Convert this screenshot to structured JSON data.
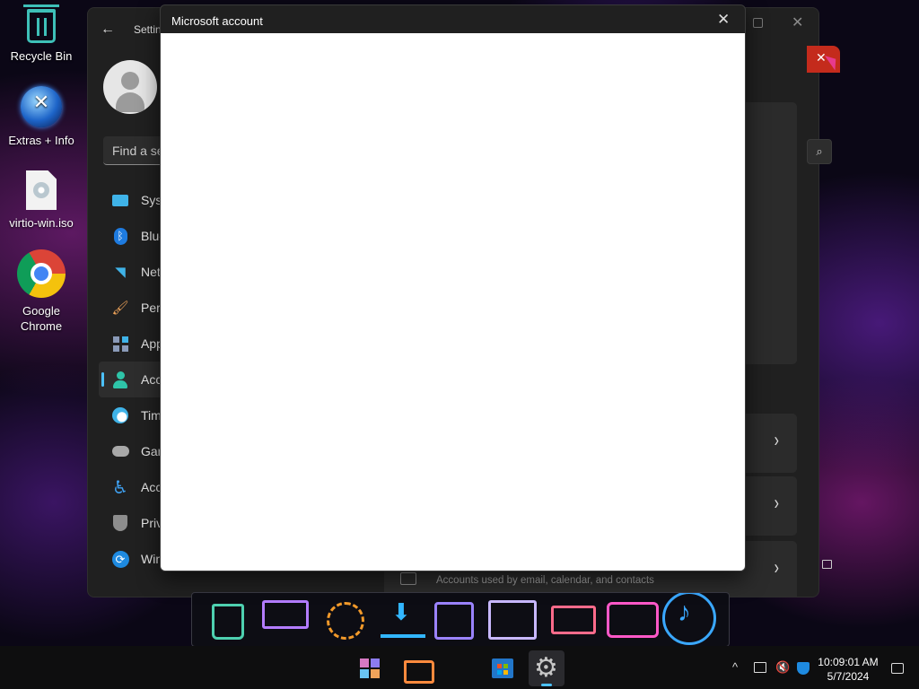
{
  "desktop": {
    "icons": [
      {
        "label": "Recycle Bin"
      },
      {
        "label": "Extras + Info"
      },
      {
        "label": "virtio-win.iso"
      },
      {
        "label": "Google Chrome"
      }
    ]
  },
  "settings": {
    "title": "Settings",
    "search_placeholder": "Find a setting",
    "nav": [
      {
        "label": "System",
        "icon": "monitor-icon"
      },
      {
        "label": "Bluetooth & devices",
        "icon": "bluetooth-icon"
      },
      {
        "label": "Network & internet",
        "icon": "wifi-icon"
      },
      {
        "label": "Personalization",
        "icon": "brush-icon"
      },
      {
        "label": "Apps",
        "icon": "apps-icon"
      },
      {
        "label": "Accounts",
        "icon": "person-icon",
        "active": true
      },
      {
        "label": "Time & language",
        "icon": "clock-globe-icon"
      },
      {
        "label": "Gaming",
        "icon": "gamepad-icon"
      },
      {
        "label": "Accessibility",
        "icon": "accessibility-icon"
      },
      {
        "label": "Privacy & security",
        "icon": "shield-icon"
      },
      {
        "label": "Windows Update",
        "icon": "update-icon"
      }
    ],
    "contacts_description": "Accounts used by email, calendar, and contacts"
  },
  "dialog": {
    "title": "Microsoft account"
  },
  "taskbar": {
    "time": "10:09:01 AM",
    "date": "5/7/2024"
  }
}
